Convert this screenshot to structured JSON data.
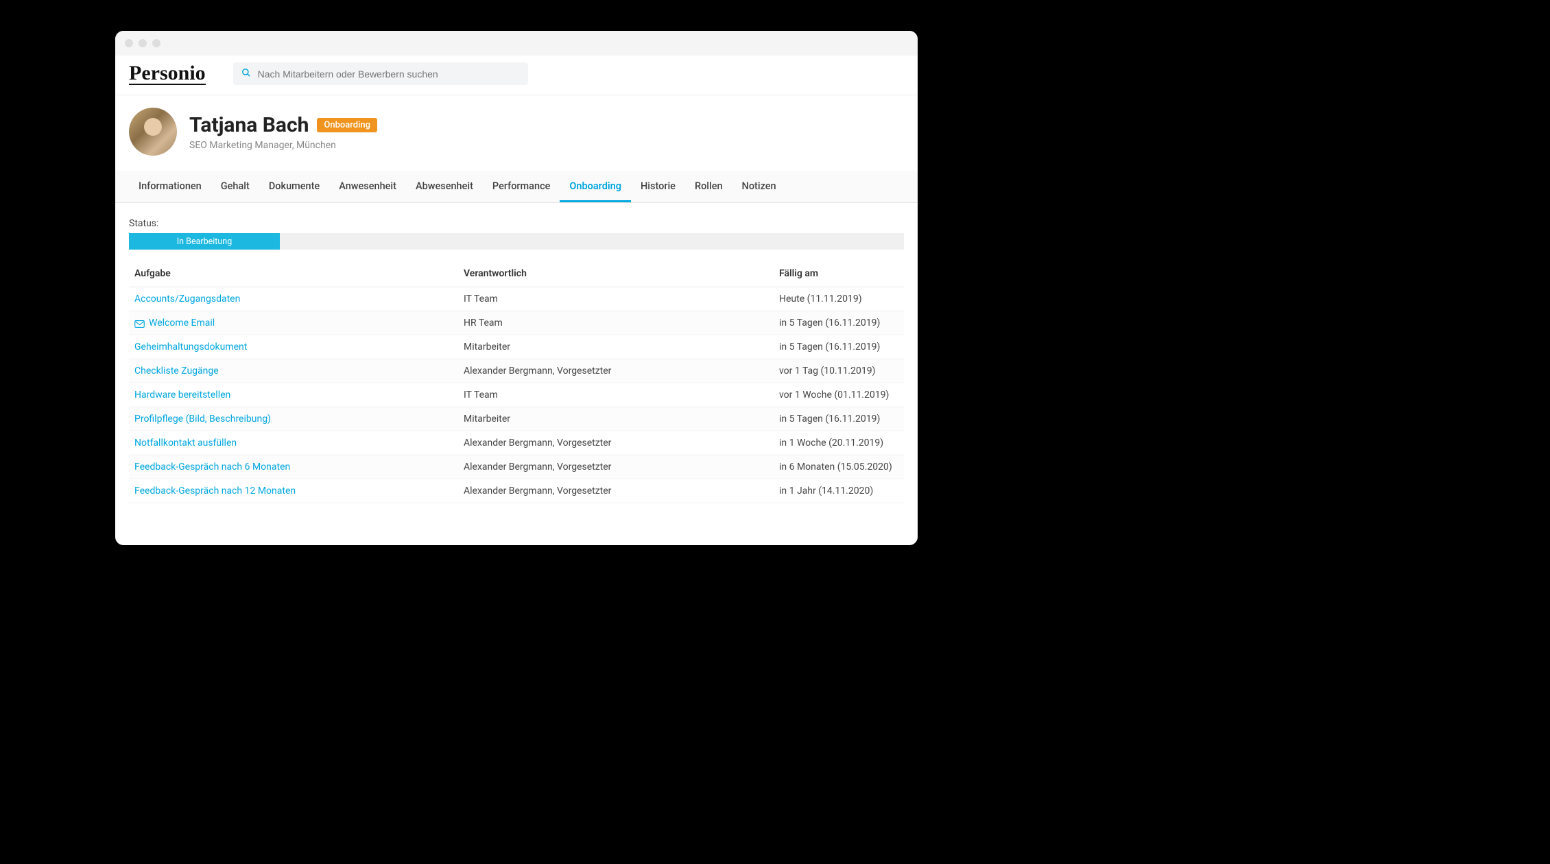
{
  "logo_text": "Personio",
  "search": {
    "placeholder": "Nach Mitarbeitern oder Bewerbern suchen"
  },
  "employee": {
    "name": "Tatjana Bach",
    "badge": "Onboarding",
    "subtitle": "SEO Marketing Manager, München"
  },
  "tabs": [
    {
      "label": "Informationen",
      "active": false
    },
    {
      "label": "Gehalt",
      "active": false
    },
    {
      "label": "Dokumente",
      "active": false
    },
    {
      "label": "Anwesenheit",
      "active": false
    },
    {
      "label": "Abwesenheit",
      "active": false
    },
    {
      "label": "Performance",
      "active": false
    },
    {
      "label": "Onboarding",
      "active": true
    },
    {
      "label": "Historie",
      "active": false
    },
    {
      "label": "Rollen",
      "active": false
    },
    {
      "label": "Notizen",
      "active": false
    }
  ],
  "status": {
    "label": "Status:",
    "value": "In Bearbeitung"
  },
  "table": {
    "headers": {
      "task": "Aufgabe",
      "responsible": "Verantwortlich",
      "due": "Fällig am"
    },
    "rows": [
      {
        "task": "Accounts/Zugangsdaten",
        "icon": null,
        "responsible": "IT Team",
        "due": "Heute (11.11.2019)"
      },
      {
        "task": "Welcome Email",
        "icon": "mail",
        "responsible": "HR Team",
        "due": "in 5 Tagen (16.11.2019)"
      },
      {
        "task": "Geheimhaltungsdokument",
        "icon": null,
        "responsible": "Mitarbeiter",
        "due": "in 5 Tagen (16.11.2019)"
      },
      {
        "task": "Checkliste Zugänge",
        "icon": null,
        "responsible": "Alexander Bergmann, Vorgesetzter",
        "due": "vor 1 Tag (10.11.2019)"
      },
      {
        "task": "Hardware bereitstellen",
        "icon": null,
        "responsible": "IT Team",
        "due": "vor 1 Woche (01.11.2019)"
      },
      {
        "task": "Profilpflege (Bild, Beschreibung)",
        "icon": null,
        "responsible": "Mitarbeiter",
        "due": "in 5 Tagen (16.11.2019)"
      },
      {
        "task": "Notfallkontakt ausfüllen",
        "icon": null,
        "responsible": "Alexander Bergmann, Vorgesetzter",
        "due": "in 1 Woche (20.11.2019)"
      },
      {
        "task": "Feedback-Gespräch nach 6 Monaten",
        "icon": null,
        "responsible": "Alexander Bergmann, Vorgesetzter",
        "due": "in 6 Monaten (15.05.2020)"
      },
      {
        "task": "Feedback-Gespräch nach 12 Monaten",
        "icon": null,
        "responsible": "Alexander Bergmann, Vorgesetzter",
        "due": "in 1 Jahr (14.11.2020)"
      }
    ]
  }
}
